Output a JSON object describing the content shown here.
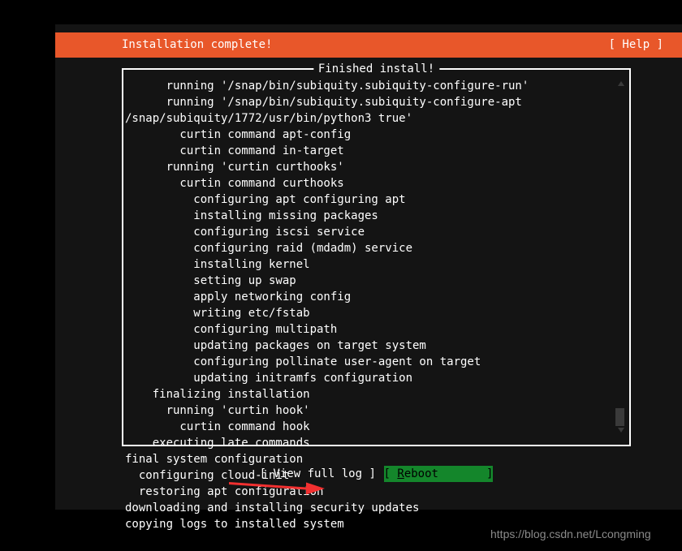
{
  "header": {
    "title": "Installation complete!",
    "help_label": "[ Help ]",
    "background_color": "#e8572a",
    "text_color": "#ffffff"
  },
  "log_panel": {
    "title": "Finished install!",
    "lines": [
      "      running '/snap/bin/subiquity.subiquity-configure-run'",
      "      running '/snap/bin/subiquity.subiquity-configure-apt",
      "/snap/subiquity/1772/usr/bin/python3 true'",
      "        curtin command apt-config",
      "        curtin command in-target",
      "      running 'curtin curthooks'",
      "        curtin command curthooks",
      "          configuring apt configuring apt",
      "          installing missing packages",
      "          configuring iscsi service",
      "          configuring raid (mdadm) service",
      "          installing kernel",
      "          setting up swap",
      "          apply networking config",
      "          writing etc/fstab",
      "          configuring multipath",
      "          updating packages on target system",
      "          configuring pollinate user-agent on target",
      "          updating initramfs configuration",
      "    finalizing installation",
      "      running 'curtin hook'",
      "        curtin command hook",
      "    executing late commands",
      "final system configuration",
      "  configuring cloud-init",
      "  restoring apt configuration",
      "downloading and installing security updates",
      "copying logs to installed system"
    ],
    "scrollbar": {
      "up_arrow": "scroll-up-arrow",
      "down_arrow": "scroll-down-arrow",
      "thumb_position_percent": 92
    }
  },
  "footer": {
    "view_log": {
      "label": "[ View full log ]",
      "selected": false
    },
    "reboot": {
      "prefix": "[ ",
      "accel": "R",
      "rest": "eboot",
      "suffix": "       ]",
      "selected": true,
      "highlight_color": "#14862b",
      "text_color": "#000000"
    }
  },
  "annotation": {
    "arrow_color": "#f23030",
    "points_to": "reboot-button"
  },
  "watermark": {
    "text": "https://blog.csdn.net/Lcongming",
    "color": "#8a8a8a"
  }
}
